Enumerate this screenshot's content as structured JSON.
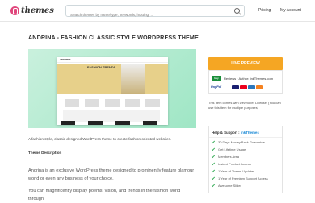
{
  "header": {
    "logo_text": "themes",
    "search_placeholder": "Search themes by name/type, keywords, hosting, ...",
    "nav": [
      "Pricing",
      "My Account"
    ]
  },
  "page": {
    "title": "ANDRINA - FASHION CLASSIC STYLE WORDPRESS THEME",
    "preview": {
      "site_name": "ANDRINA",
      "banner_title": "FASHION TRENDS"
    },
    "intro": "A fashion style, classic designed WordPress theme to create fashion oriented websites.",
    "desc_heading": "Theme Description",
    "desc_p1": "Andrina is an exclusive WordPress theme designed to prominently feature glamour world or even any business of your choice.",
    "desc_p2": "You can magnificently display poems, vision, and trends in the fashion world through"
  },
  "sidebar": {
    "live_preview_label": "LIVE PREVIEW",
    "buy_badge": "buy",
    "buy_text": "Reviews · Author: InkThemes.com",
    "pay_label": "PayPal",
    "notice": "This Item comes with Developer License. (You can use this item for multiple purposes)",
    "help_heading_prefix": "Help & Support : ",
    "help_heading_brand": "InkThemes",
    "help_items": [
      "30 Days Money Back Guarantee",
      "Get Lifetime Usage",
      "Members Area",
      "Instant Product Access",
      "1 Year of Theme Updates",
      "1 Year of Premium Support Access",
      "Awesome Slider"
    ]
  },
  "colors": {
    "accent_orange": "#f5a623",
    "brand_pink": "#e0457b",
    "check_green": "#3cae5c",
    "link_blue": "#1b8ad6"
  }
}
